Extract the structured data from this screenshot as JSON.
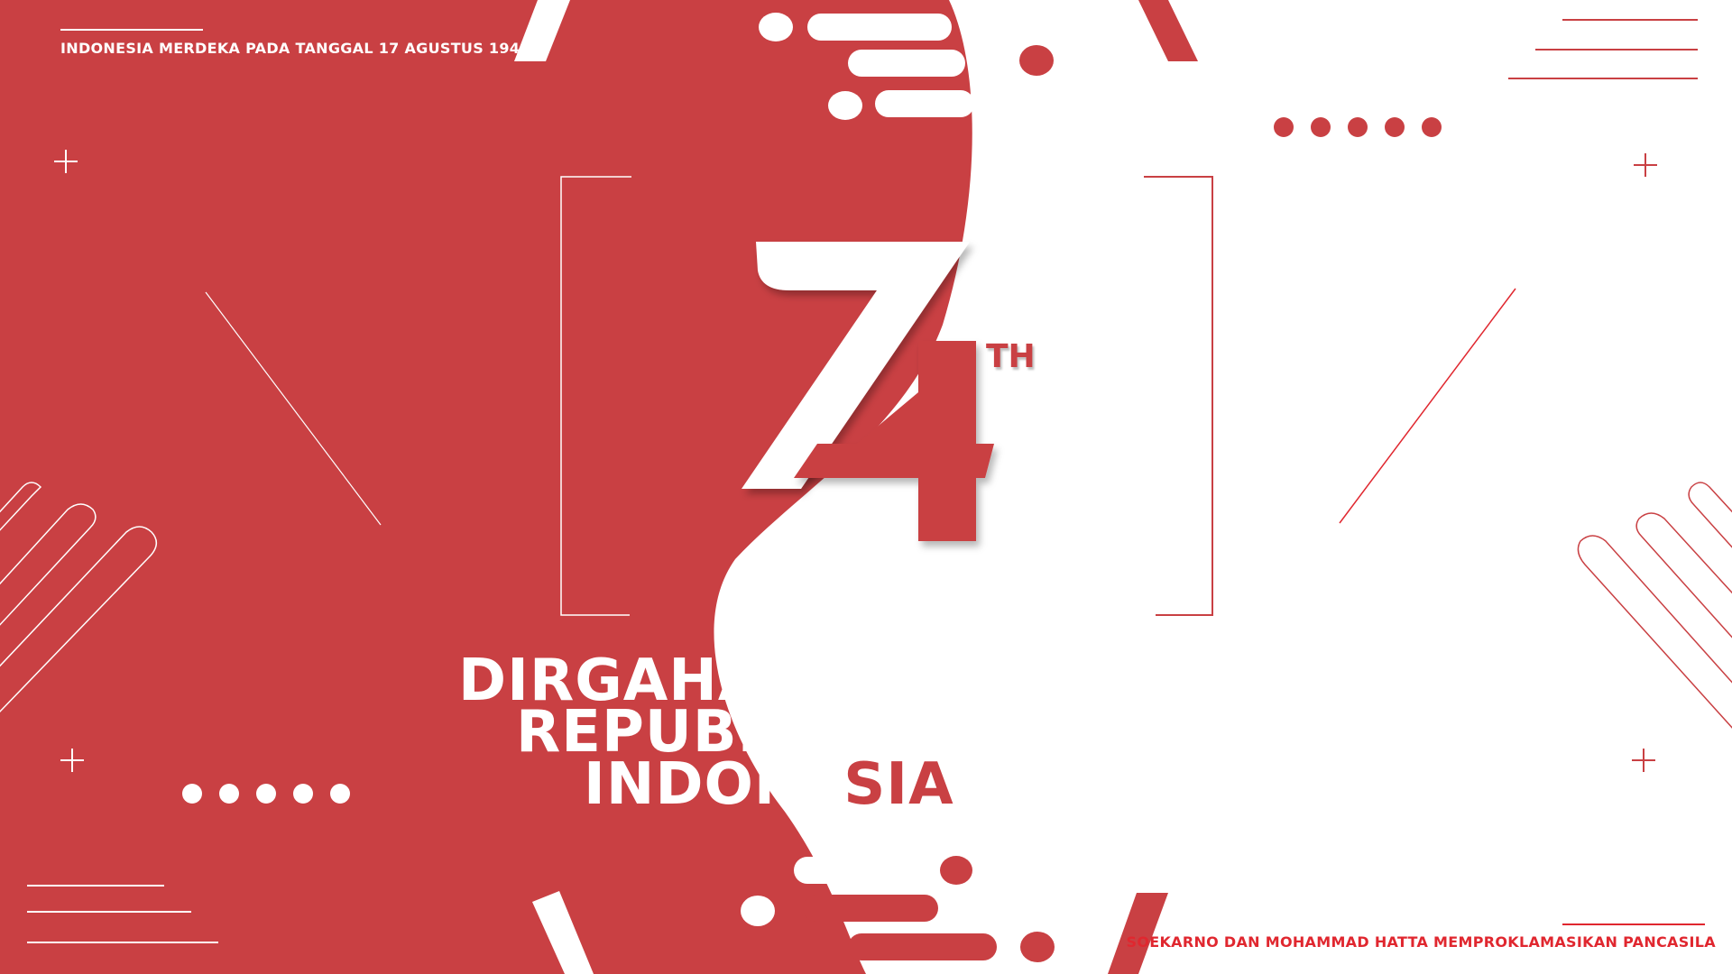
{
  "top_caption": "INDONESIA MERDEKA PADA TANGGAL 17 AGUSTUS 1945",
  "bottom_caption": "SOEKARNO DAN MOHAMMAD HATTA MEMPROKLAMASIKAN PANCASILA",
  "anniversary": {
    "number": "74",
    "suffix": "TH"
  },
  "headline": {
    "line1": "DIRGAHAYU",
    "line2": "REPUBLIK",
    "line3_part1": "INDONE",
    "line3_part2": "SIA"
  },
  "colors": {
    "red": "#c94043",
    "white": "#ffffff",
    "accent_red": "#e0272f"
  }
}
